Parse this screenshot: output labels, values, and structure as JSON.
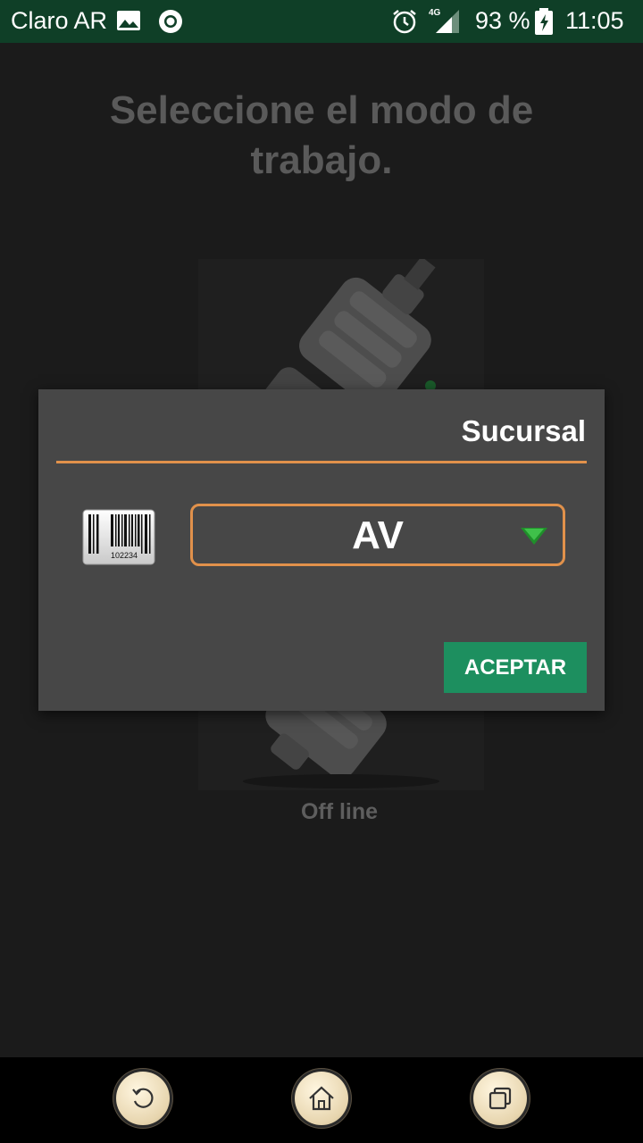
{
  "status_bar": {
    "carrier": "Claro AR",
    "network_type": "4G",
    "battery_percent": "93 %",
    "time": "11:05",
    "icons": [
      "image-icon",
      "record-icon",
      "alarm-icon",
      "signal-icon",
      "battery-charging-icon"
    ]
  },
  "page": {
    "title": "Seleccione el modo de trabajo.",
    "mode_label": "Off line"
  },
  "dialog": {
    "title": "Sucursal",
    "spinner_value": "AV",
    "barcode_number": "102234",
    "accept_label": "ACEPTAR",
    "accent_color": "#e1914b",
    "button_color": "#1d8f5f"
  },
  "nav_bar": {
    "buttons": [
      "back-icon",
      "home-icon",
      "recents-icon"
    ]
  }
}
